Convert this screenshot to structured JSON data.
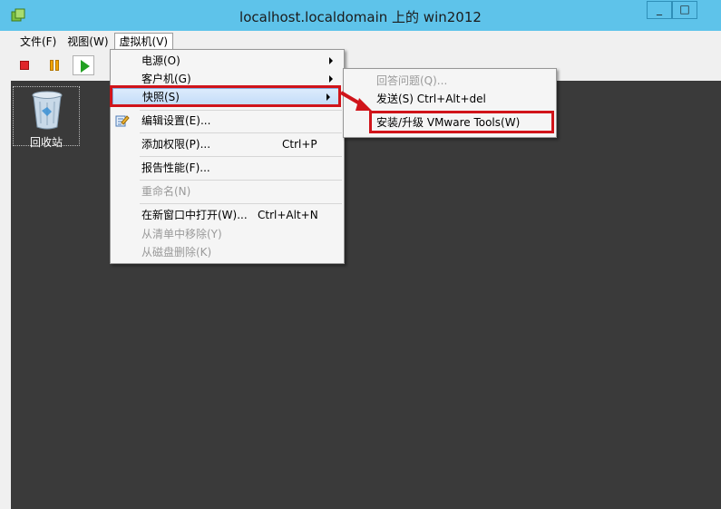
{
  "window": {
    "title": "localhost.localdomain 上的 win2012",
    "minimize_glyph": "_",
    "maximize_glyph": "□"
  },
  "menubar": {
    "items": [
      {
        "label": "文件(F)"
      },
      {
        "label": "视图(W)"
      },
      {
        "label": "虚拟机(V)"
      }
    ]
  },
  "toolbar": {
    "buttons": [
      "stop-icon",
      "pause-icon",
      "play-icon"
    ]
  },
  "desktop": {
    "icons": [
      {
        "label": "回收站",
        "icon": "recycle-bin-icon"
      }
    ]
  },
  "vm_menu": {
    "items": [
      {
        "label": "电源(O)",
        "submenu": true
      },
      {
        "label": "客户机(G)",
        "submenu": true
      },
      {
        "label": "快照(S)",
        "submenu": true,
        "highlighted": true
      },
      {
        "label": "编辑设置(E)...",
        "icon": "edit-settings-icon"
      },
      {
        "label": "添加权限(P)...",
        "shortcut": "Ctrl+P"
      },
      {
        "label": "报告性能(F)..."
      },
      {
        "label": "重命名(N)",
        "disabled": true
      },
      {
        "label": "在新窗口中打开(W)...",
        "shortcut": "Ctrl+Alt+N"
      },
      {
        "label": "从清单中移除(Y)",
        "disabled": true
      },
      {
        "label": "从磁盘删除(K)",
        "disabled": true
      }
    ]
  },
  "guest_submenu": {
    "items": [
      {
        "label": "回答问题(Q)...",
        "disabled": true
      },
      {
        "label": "发送(S) Ctrl+Alt+del"
      },
      {
        "label": "安装/升级 VMware Tools(W)",
        "highlighted": true
      }
    ]
  },
  "colors": {
    "titlebar": "#5ec3ea",
    "highlight_box": "#d0141a",
    "desktop": "#3a3a3a"
  }
}
